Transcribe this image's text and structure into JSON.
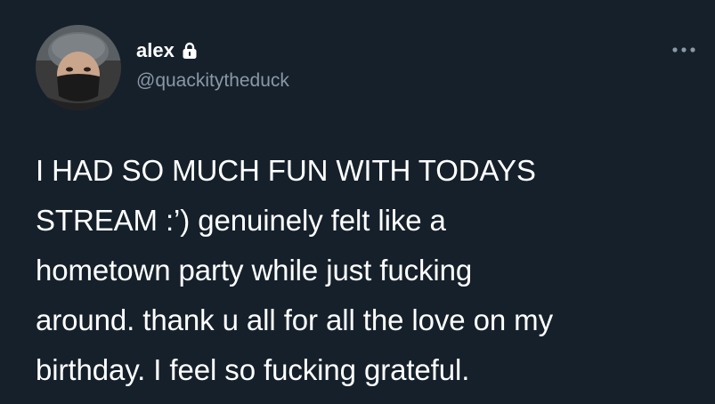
{
  "tweet": {
    "author": {
      "display_name": "alex",
      "handle": "@quackitytheduck",
      "avatar_icon": "user-avatar",
      "verified_lock_icon": "lock-icon"
    },
    "more_icon": "more-dots-icon",
    "text_lines": [
      "I HAD SO MUCH FUN WITH TODAYS",
      "STREAM :’) genuinely felt like a",
      "hometown party while just fucking",
      "around. thank u all for all the love on my",
      "birthday. I feel so fucking grateful."
    ]
  },
  "colors": {
    "background": "#15202b",
    "primary_text": "#ffffff",
    "secondary_text": "#8b98a5"
  }
}
